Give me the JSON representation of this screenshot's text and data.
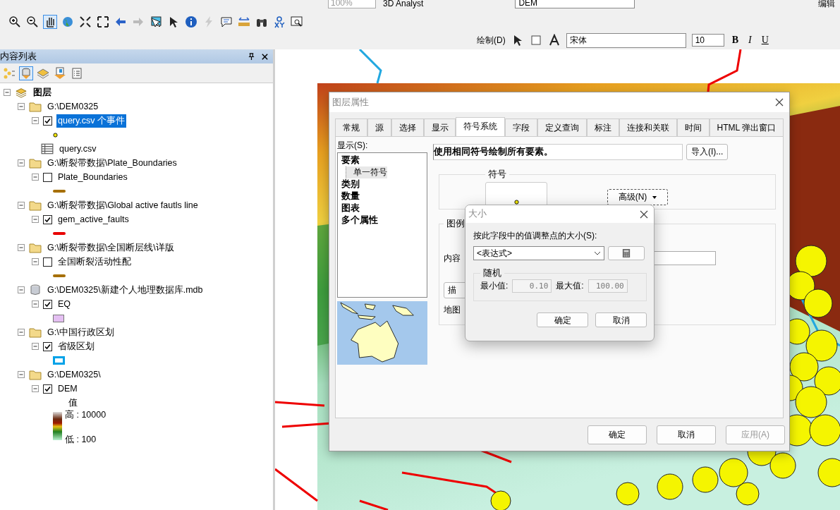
{
  "toolbar": {
    "zoom": "100%",
    "analyst": "3D Analyst",
    "layer": "DEM",
    "editor": "编辑",
    "draw_menu": "绘制(D)",
    "font": "宋体",
    "font_size": "10",
    "bold": "B",
    "italic": "I",
    "underline": "U"
  },
  "toc": {
    "title": "内容列表",
    "root": "图层",
    "groups": [
      {
        "kind": "folder",
        "path": "G:\\DEM0325",
        "expanded": true,
        "layers": [
          {
            "kind": "layer",
            "name": "query.csv 个事件",
            "checked": true,
            "selected": true,
            "symbol": {
              "kind": "point",
              "color": "#f2e600"
            }
          },
          {
            "kind": "table",
            "name": "query.csv",
            "selected": false
          }
        ]
      },
      {
        "kind": "folder",
        "path": "G:\\断裂带数据\\Plate_Boundaries",
        "expanded": true,
        "layers": [
          {
            "kind": "layer",
            "name": "Plate_Boundaries",
            "checked": false,
            "selected": false,
            "symbol": {
              "kind": "line",
              "color": "#a66f00"
            }
          }
        ]
      },
      {
        "kind": "folder",
        "path": "G:\\断裂带数据\\Global active fautls line",
        "expanded": true,
        "layers": [
          {
            "kind": "layer",
            "name": "gem_active_faults",
            "checked": true,
            "selected": false,
            "symbol": {
              "kind": "line",
              "color": "#e80000"
            }
          }
        ]
      },
      {
        "kind": "folder",
        "path": "G:\\断裂带数据\\全国断层线\\详版",
        "expanded": true,
        "layers": [
          {
            "kind": "layer",
            "name": "全国断裂活动性配",
            "checked": false,
            "selected": false,
            "symbol": {
              "kind": "line",
              "color": "#a66f00"
            }
          }
        ]
      },
      {
        "kind": "database",
        "path": "G:\\DEM0325\\新建个人地理数据库.mdb",
        "expanded": true,
        "layers": [
          {
            "kind": "layer",
            "name": "EQ",
            "checked": true,
            "selected": false,
            "symbol": {
              "kind": "fill",
              "color": "#e4bff2"
            }
          }
        ]
      },
      {
        "kind": "folder",
        "path": "G:\\中国行政区划",
        "expanded": true,
        "layers": [
          {
            "kind": "layer",
            "name": "省级区划",
            "checked": true,
            "selected": false,
            "symbol": {
              "kind": "outline",
              "color": "#00a2e8"
            }
          }
        ]
      },
      {
        "kind": "folder",
        "path": "G:\\DEM0325\\",
        "expanded": true,
        "layers": [
          {
            "kind": "layer",
            "name": "DEM",
            "checked": true,
            "selected": false,
            "symbol": {
              "kind": "ramp",
              "title": "值",
              "high": "高 : 10000",
              "low": "低 : 100"
            }
          }
        ]
      }
    ]
  },
  "properties": {
    "title": "图层属性",
    "tabs": [
      {
        "label": "常规",
        "selected": false
      },
      {
        "label": "源",
        "selected": false
      },
      {
        "label": "选择",
        "selected": false
      },
      {
        "label": "显示",
        "selected": false
      },
      {
        "label": "符号系统",
        "selected": true
      },
      {
        "label": "字段",
        "selected": false
      },
      {
        "label": "定义查询",
        "selected": false
      },
      {
        "label": "标注",
        "selected": false
      },
      {
        "label": "连接和关联",
        "selected": false
      },
      {
        "label": "时间",
        "selected": false
      },
      {
        "label": "HTML 弹出窗口",
        "selected": false
      }
    ],
    "show_label": "显示(S):",
    "tree": [
      {
        "label": "要素",
        "selected": false,
        "children": [
          {
            "label": "单一符号",
            "selected": true
          }
        ]
      },
      {
        "label": "类别",
        "selected": false
      },
      {
        "label": "数量",
        "selected": false
      },
      {
        "label": "图表",
        "selected": false
      },
      {
        "label": "多个属性",
        "selected": false
      }
    ],
    "description": "使用相同符号绘制所有要素。",
    "import_button": "导入(I)...",
    "symbol_group": "符号",
    "advanced_button": "高级(N)",
    "legend_group": "图例",
    "legend_label": "内容",
    "legend_button": "描",
    "map_label": "地图",
    "buttons": [
      {
        "label": "确定",
        "disabled": false
      },
      {
        "label": "取消",
        "disabled": false
      },
      {
        "label": "应用(A)",
        "disabled": true
      }
    ]
  },
  "size_dialog": {
    "title": "大小",
    "field_label": "按此字段中的值调整点的大小(S):",
    "field_value": "<表达式>",
    "random_group": "随机",
    "min_label": "最小值:",
    "min_value": "0.10",
    "max_label": "最大值:",
    "max_value": "100.00",
    "buttons": [
      {
        "label": "确定",
        "disabled": false
      },
      {
        "label": "取消",
        "disabled": false
      }
    ]
  }
}
